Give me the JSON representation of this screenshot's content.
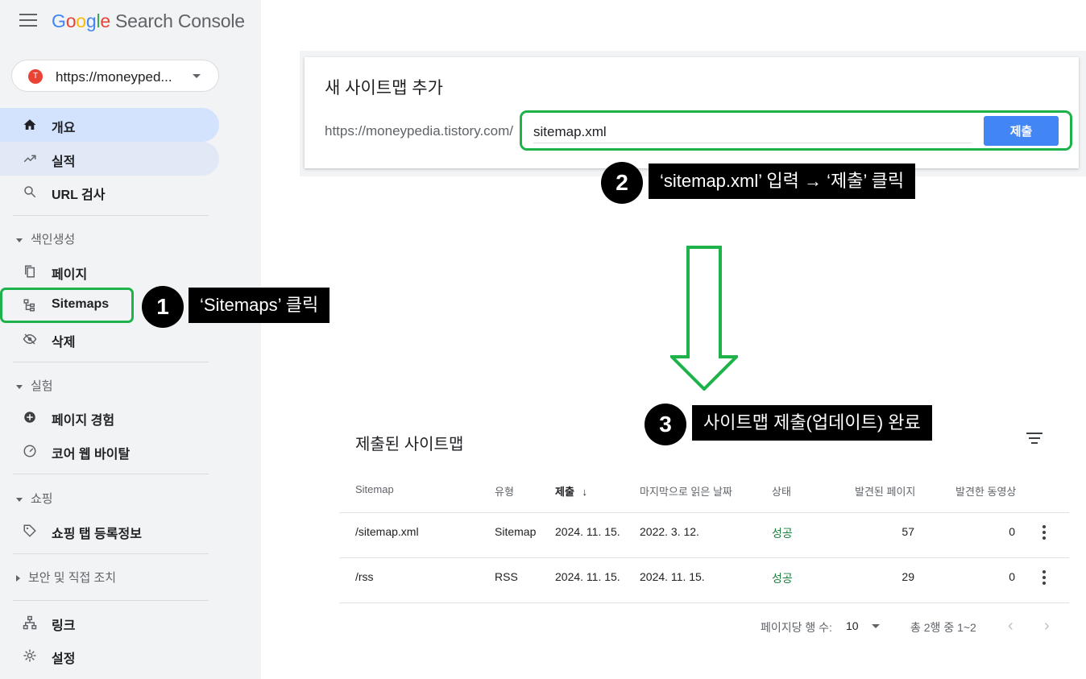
{
  "header": {
    "logo_letters": [
      "G",
      "o",
      "o",
      "g",
      "l",
      "e"
    ],
    "product": "Search Console"
  },
  "property": {
    "url": "https://moneyped...",
    "favicon_letter": "T"
  },
  "sidebar": {
    "top_items": [
      {
        "label": "개요",
        "icon": "home-icon",
        "state": "active"
      },
      {
        "label": "실적",
        "icon": "trending-up-icon",
        "state": "hover"
      },
      {
        "label": "URL 검사",
        "icon": "search-icon",
        "state": ""
      }
    ],
    "sections": {
      "indexing": {
        "title": "색인생성",
        "items": [
          "페이지",
          "Sitemaps",
          "삭제"
        ]
      },
      "experience": {
        "title": "실험",
        "items": [
          "페이지 경험",
          "코어 웹 바이탈"
        ]
      },
      "shopping": {
        "title": "쇼핑",
        "items": [
          "쇼핑 탭 등록정보"
        ]
      },
      "security": {
        "title": "보안 및 직접 조치"
      }
    },
    "bottom_items": [
      "링크",
      "설정"
    ]
  },
  "add_sitemap": {
    "title": "새 사이트맵 추가",
    "prefix": "https://moneypedia.tistory.com/",
    "input_value": "sitemap.xml",
    "submit_label": "제출"
  },
  "annotations": [
    {
      "number": "1",
      "text": "‘Sitemaps’ 클릭"
    },
    {
      "number": "2",
      "text": "‘sitemap.xml’ 입력 → ‘제출’ 클릭"
    },
    {
      "number": "3",
      "text": "사이트맵 제출(업데이트) 완료"
    }
  ],
  "submitted": {
    "title": "제출된 사이트맵",
    "columns": [
      "Sitemap",
      "유형",
      "제출",
      "마지막으로 읽은 날짜",
      "상태",
      "발견된 페이지",
      "발견한 동영상"
    ],
    "sort_arrow": "↓",
    "rows": [
      {
        "sitemap": "/sitemap.xml",
        "type": "Sitemap",
        "submitted": "2024. 11. 15.",
        "last_read": "2022. 3. 12.",
        "status": "성공",
        "pages": "57",
        "videos": "0"
      },
      {
        "sitemap": "/rss",
        "type": "RSS",
        "submitted": "2024. 11. 15.",
        "last_read": "2024. 11. 15.",
        "status": "성공",
        "pages": "29",
        "videos": "0"
      }
    ],
    "pagination": {
      "rows_label": "페이지당 행 수:",
      "rows_value": "10",
      "range": "총 2행 중 1~2",
      "prev": "‹",
      "next": "›"
    }
  },
  "colors": {
    "accent": "#4285f4",
    "highlight": "#1db34a",
    "success": "#188038",
    "active_nav": "#d3e3fd"
  }
}
